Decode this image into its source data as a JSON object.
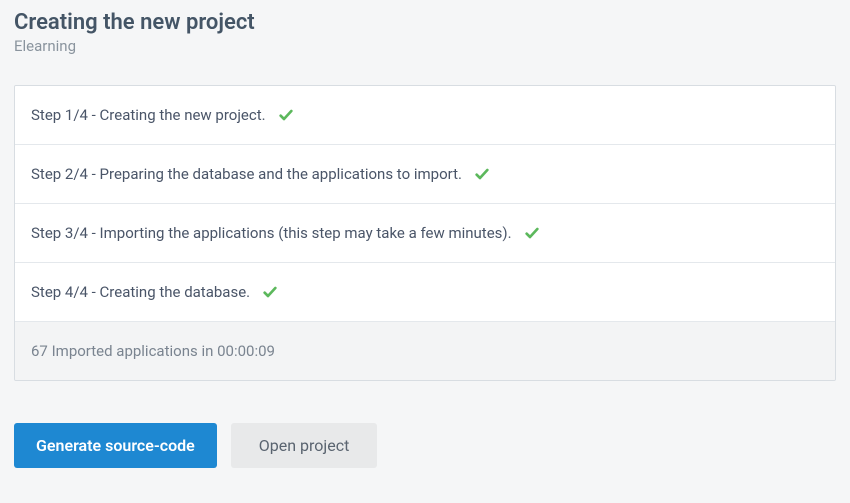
{
  "header": {
    "title": "Creating the new project",
    "subtitle": "Elearning"
  },
  "steps": [
    {
      "label": "Step 1/4 - Creating the new project.",
      "done": true
    },
    {
      "label": "Step 2/4 - Preparing the database and the applications to import.",
      "done": true
    },
    {
      "label": "Step 3/4 - Importing the applications (this step may take a few minutes).",
      "done": true
    },
    {
      "label": "Step 4/4 - Creating the database.",
      "done": true
    }
  ],
  "status": {
    "message": "67 Imported applications in 00:00:09"
  },
  "buttons": {
    "generate": "Generate source-code",
    "open": "Open project"
  }
}
